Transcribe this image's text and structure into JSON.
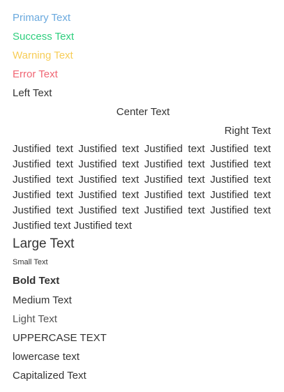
{
  "colored": {
    "primary": "Primary Text",
    "success": "Success Text",
    "warning": "Warning Text",
    "error": "Error Text"
  },
  "alignment": {
    "left": "Left Text",
    "center": "Center Text",
    "right": "Right Text",
    "justified": "Justified text Justified text Justified text Justified text Justified text Justified text Justified text Justified text Justified text Justified text Justified text Justified text Justified text Justified text Justified text Justified text Justified text Justified text Justified text Justified text Justified text Justified text"
  },
  "sizes": {
    "large": "Large Text",
    "small": "Small Text"
  },
  "weights": {
    "bold": "Bold Text",
    "medium": "Medium Text",
    "light": "Light Text"
  },
  "transforms": {
    "uppercase": "UPPERCASE TEXT",
    "lowercase": "lowercase text",
    "capitalized": "Capitalized Text"
  },
  "colors": {
    "primary": "#6aa9de",
    "success": "#2fcf7e",
    "warning": "#f7cd57",
    "error": "#f06674",
    "default": "#333333"
  }
}
